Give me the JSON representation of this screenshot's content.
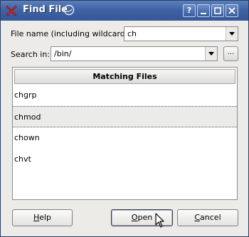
{
  "window": {
    "title": "Find File",
    "icons": {
      "app": "red-x-icon",
      "help": "help-icon",
      "minimize": "minimize-icon",
      "maximize": "maximize-icon",
      "close": "close-icon",
      "moon": "moon-icon"
    },
    "help_glyph": "?"
  },
  "filename": {
    "label": "File name (including wildcards):",
    "value": "ch"
  },
  "search_in": {
    "label": "Search in:",
    "value": "/bin/",
    "browse_label": "..."
  },
  "list": {
    "header": "Matching Files",
    "items": [
      "chgrp",
      "chmod",
      "chown",
      "chvt"
    ],
    "selected": "chmod"
  },
  "buttons": {
    "help": {
      "pre": "",
      "key": "H",
      "post": "elp"
    },
    "open": {
      "pre": "",
      "key": "O",
      "post": "pen"
    },
    "cancel": {
      "pre": "",
      "key": "C",
      "post": "ancel"
    }
  }
}
